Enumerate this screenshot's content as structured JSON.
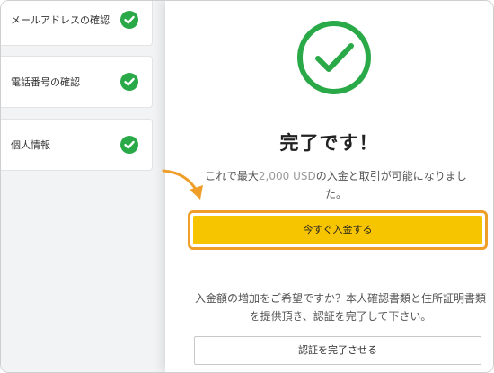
{
  "steps": [
    {
      "label": "メールアドレスの確認",
      "status_icon": "check-circle-icon"
    },
    {
      "label": "電話番号の確認",
      "status_icon": "check-circle-icon"
    },
    {
      "label": "個人情報",
      "status_icon": "check-circle-icon"
    }
  ],
  "completion": {
    "title": "完了です！",
    "message_prefix": "これで最大",
    "amount": "2,000 USD",
    "message_suffix": "の入金と取引が可能になりました。"
  },
  "deposit_button": {
    "label": "今すぐ入金する"
  },
  "upgrade_text": "入金額の増加をご希望ですか？本人確認書類と住所証明書類を提供頂き、認証を完了して下さい。",
  "verify_button": {
    "label": "認証を完了させる"
  },
  "colors": {
    "success_green": "#2aa948",
    "primary_yellow": "#f7c400",
    "highlight_orange": "#ef9e2a"
  }
}
